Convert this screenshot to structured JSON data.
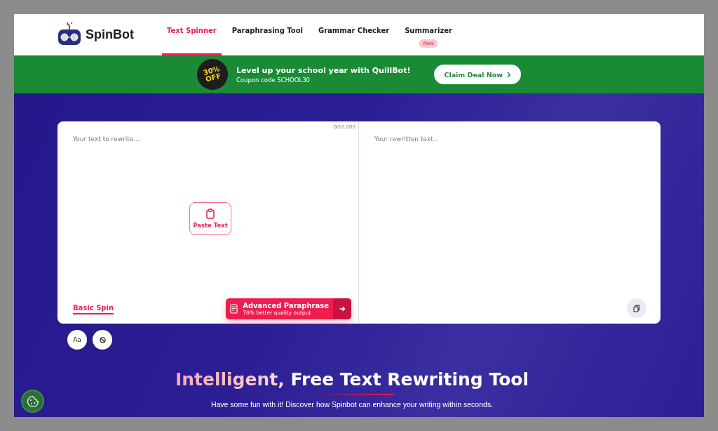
{
  "header": {
    "logo": "SpinBot",
    "nav": [
      {
        "label": "Text Spinner",
        "selected": true
      },
      {
        "label": "Paraphrasing Tool",
        "selected": false
      },
      {
        "label": "Grammar Checker",
        "selected": false
      },
      {
        "label": "Summarizer",
        "selected": false,
        "badge": "New"
      }
    ]
  },
  "promo": {
    "sticker": "30% OFF",
    "title": "Level up your school year with QuillBot!",
    "subtitle": "Coupon code SCHOOL30",
    "button": "Claim Deal Now"
  },
  "editor": {
    "counter": {
      "count": "0",
      "limit": "/10,000"
    },
    "input_placeholder": "Your text to rewrite...",
    "paste_button": "Paste Text",
    "modes": [
      {
        "label": "Basic Spin",
        "selected": true
      }
    ],
    "advanced": {
      "title": "Advanced Paraphrase",
      "subtitle": "70% better quality output"
    },
    "output_placeholder": "Your rewritten text..."
  },
  "tools": [
    "Aa"
  ],
  "hero": {
    "highlight": "Intelligent,",
    "title": "Free Text Rewriting Tool",
    "subtitle": "Have some fun with it! Discover how Spinbot can enhance your writing within seconds."
  }
}
